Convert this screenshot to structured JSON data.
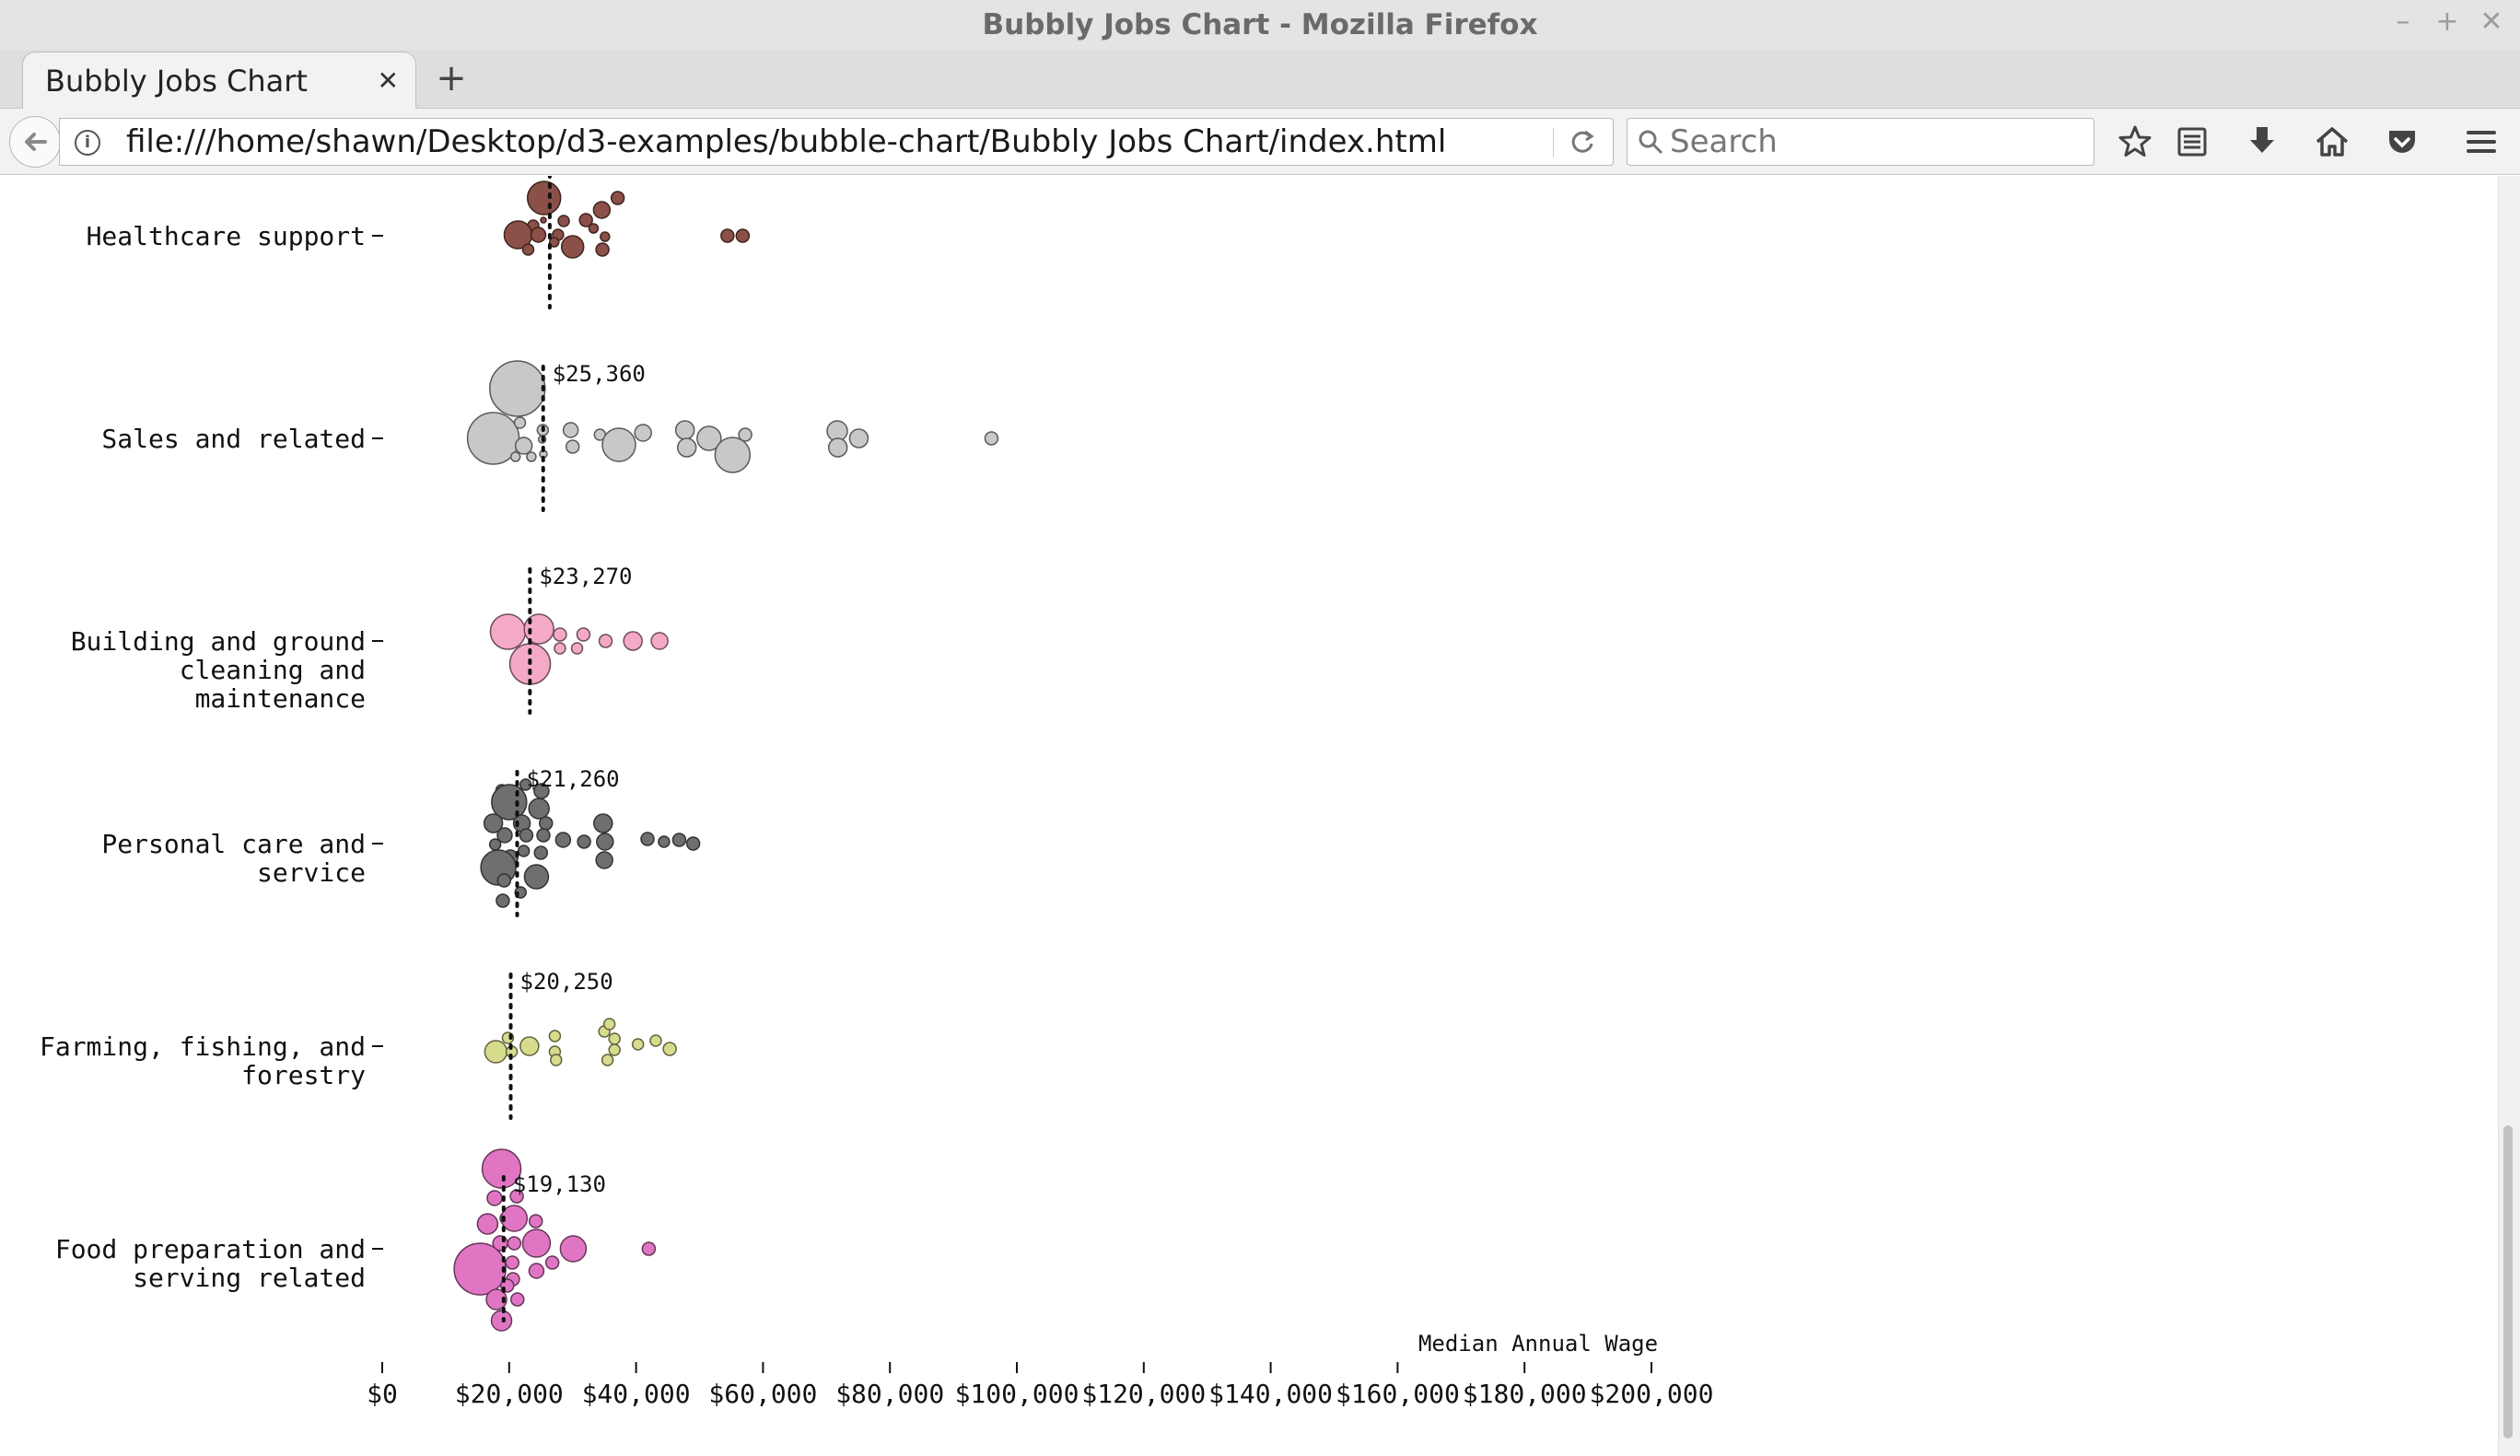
{
  "window": {
    "title": "Bubbly Jobs Chart - Mozilla Firefox",
    "controls": [
      "–",
      "+",
      "✕"
    ]
  },
  "tab": {
    "label": "Bubbly Jobs Chart",
    "close": "✕",
    "new_tab": "+"
  },
  "navbar": {
    "url": "file:///home/shawn/Desktop/d3-examples/bubble-chart/Bubbly Jobs Chart/index.html",
    "search_placeholder": "Search",
    "icons": [
      "back-icon",
      "info-icon",
      "reload-icon",
      "search-icon",
      "bookmark-star-icon",
      "reading-list-icon",
      "download-icon",
      "home-icon",
      "pocket-icon",
      "menu-icon"
    ]
  },
  "chart_data": {
    "type": "scatter",
    "xlabel": "Median Annual Wage",
    "ylabel": "",
    "xlim": [
      0,
      200000
    ],
    "x_ticks": [
      "$0",
      "$20,000",
      "$40,000",
      "$60,000",
      "$80,000",
      "$100,000",
      "$120,000",
      "$140,000",
      "$160,000",
      "$180,000",
      "$200,000"
    ],
    "grid": false,
    "groups": [
      {
        "name": "Healthcare support",
        "label_lines": [
          "Healthcare support"
        ],
        "median": 26400,
        "median_label": "",
        "color": "#8b5048",
        "bubbles": [
          [
            25400,
            -17,
            3
          ],
          [
            25500,
            -41,
            18
          ],
          [
            23800,
            -11,
            6
          ],
          [
            28600,
            -16,
            6
          ],
          [
            32100,
            -17,
            7
          ],
          [
            34600,
            -28,
            9
          ],
          [
            37100,
            -41,
            7
          ],
          [
            21400,
            -1,
            15
          ],
          [
            24600,
            -1,
            8
          ],
          [
            27700,
            -1,
            6
          ],
          [
            33300,
            -8,
            5
          ],
          [
            35100,
            1,
            5
          ],
          [
            30000,
            12,
            12
          ],
          [
            23000,
            15,
            6
          ],
          [
            27100,
            7,
            5
          ],
          [
            34700,
            15,
            7
          ],
          [
            54400,
            0,
            7
          ],
          [
            56800,
            0,
            7
          ]
        ]
      },
      {
        "name": "Sales and related",
        "label_lines": [
          "Sales and related"
        ],
        "median": 25360,
        "median_label": "$25,360",
        "color": "#c8c8c8",
        "bubbles": [
          [
            21300,
            -54,
            30
          ],
          [
            17500,
            0,
            28
          ],
          [
            21700,
            -17,
            6
          ],
          [
            25300,
            -9,
            6
          ],
          [
            29700,
            -9,
            8
          ],
          [
            34300,
            -4,
            6
          ],
          [
            41100,
            -6,
            9
          ],
          [
            47700,
            -9,
            10
          ],
          [
            25200,
            1,
            4
          ],
          [
            22300,
            8,
            9
          ],
          [
            25400,
            17,
            4
          ],
          [
            21000,
            20,
            5
          ],
          [
            23500,
            20,
            5
          ],
          [
            30000,
            9,
            7
          ],
          [
            37300,
            7,
            18
          ],
          [
            48000,
            10,
            10
          ],
          [
            51500,
            0,
            13
          ],
          [
            55200,
            18,
            19
          ],
          [
            57200,
            -4,
            7
          ],
          [
            71700,
            -8,
            11
          ],
          [
            75100,
            0,
            10
          ],
          [
            71800,
            10,
            10
          ],
          [
            96000,
            0,
            7
          ]
        ]
      },
      {
        "name": "Building and grounds cleaning and maintenance",
        "label_lines": [
          "Building and ground",
          "cleaning and",
          "maintenance"
        ],
        "median": 23270,
        "median_label": "$23,270",
        "color": "#f4a9c6",
        "bubbles": [
          [
            19800,
            -10,
            19
          ],
          [
            24700,
            -13,
            16
          ],
          [
            28000,
            -7,
            7
          ],
          [
            31700,
            -7,
            7
          ],
          [
            35200,
            0,
            7
          ],
          [
            39500,
            0,
            10
          ],
          [
            23300,
            25,
            22
          ],
          [
            28000,
            8,
            6
          ],
          [
            30700,
            8,
            6
          ],
          [
            43700,
            0,
            9
          ]
        ]
      },
      {
        "name": "Personal care and service",
        "label_lines": [
          "Personal care and",
          "service"
        ],
        "median": 21260,
        "median_label": "$21,260",
        "color": "#6f6f6f",
        "bubbles": [
          [
            18800,
            -58,
            6
          ],
          [
            22600,
            -64,
            6
          ],
          [
            25100,
            -57,
            8
          ],
          [
            20000,
            -45,
            19
          ],
          [
            24700,
            -38,
            11
          ],
          [
            17500,
            -22,
            10
          ],
          [
            22000,
            -22,
            9
          ],
          [
            25800,
            -22,
            7
          ],
          [
            34800,
            -22,
            10
          ],
          [
            19300,
            -9,
            8
          ],
          [
            22700,
            -9,
            7
          ],
          [
            25400,
            -9,
            7
          ],
          [
            28500,
            -4,
            8
          ],
          [
            31800,
            -2,
            7
          ],
          [
            35100,
            -2,
            9
          ],
          [
            41800,
            -5,
            7
          ],
          [
            44400,
            -2,
            6
          ],
          [
            46800,
            -4,
            7
          ],
          [
            49000,
            0,
            7
          ],
          [
            17800,
            1,
            6
          ],
          [
            20200,
            15,
            8
          ],
          [
            22300,
            8,
            6
          ],
          [
            25000,
            10,
            7
          ],
          [
            35000,
            18,
            9
          ],
          [
            18300,
            26,
            19
          ],
          [
            24300,
            36,
            13
          ],
          [
            19200,
            40,
            7
          ],
          [
            21800,
            53,
            6
          ],
          [
            19000,
            62,
            7
          ]
        ]
      },
      {
        "name": "Farming, fishing, and forestry",
        "label_lines": [
          "Farming, fishing, and",
          "forestry"
        ],
        "median": 20250,
        "median_label": "$20,250",
        "color": "#d6dc8c",
        "bubbles": [
          [
            19800,
            -9,
            6
          ],
          [
            27200,
            -11,
            6
          ],
          [
            35000,
            -16,
            6
          ],
          [
            35800,
            -24,
            6
          ],
          [
            17900,
            6,
            12
          ],
          [
            20400,
            6,
            6
          ],
          [
            23200,
            0,
            10
          ],
          [
            27200,
            6,
            6
          ],
          [
            27400,
            15,
            6
          ],
          [
            36600,
            4,
            6
          ],
          [
            35500,
            15,
            6
          ],
          [
            40300,
            -2,
            6
          ],
          [
            36600,
            -8,
            6
          ],
          [
            43100,
            -6,
            6
          ],
          [
            45300,
            3,
            7
          ]
        ]
      },
      {
        "name": "Food preparation and serving related",
        "label_lines": [
          "Food preparation and",
          "serving related"
        ],
        "median": 19130,
        "median_label": "$19,130",
        "color": "#e076c3",
        "bubbles": [
          [
            18800,
            -87,
            21
          ],
          [
            17700,
            -55,
            8
          ],
          [
            21200,
            -57,
            7
          ],
          [
            19600,
            -33,
            7
          ],
          [
            20800,
            -33,
            7
          ],
          [
            16600,
            -27,
            11
          ],
          [
            20800,
            -33,
            14
          ],
          [
            24200,
            -30,
            7
          ],
          [
            18600,
            -6,
            8
          ],
          [
            20800,
            -6,
            7
          ],
          [
            24300,
            -6,
            15
          ],
          [
            30100,
            0,
            14
          ],
          [
            42000,
            0,
            7
          ],
          [
            15400,
            22,
            28
          ],
          [
            20500,
            15,
            7
          ],
          [
            26800,
            15,
            7
          ],
          [
            20600,
            33,
            7
          ],
          [
            24300,
            24,
            8
          ],
          [
            19700,
            40,
            7
          ],
          [
            18000,
            55,
            11
          ],
          [
            21300,
            55,
            7
          ],
          [
            18800,
            78,
            11
          ]
        ]
      }
    ]
  }
}
